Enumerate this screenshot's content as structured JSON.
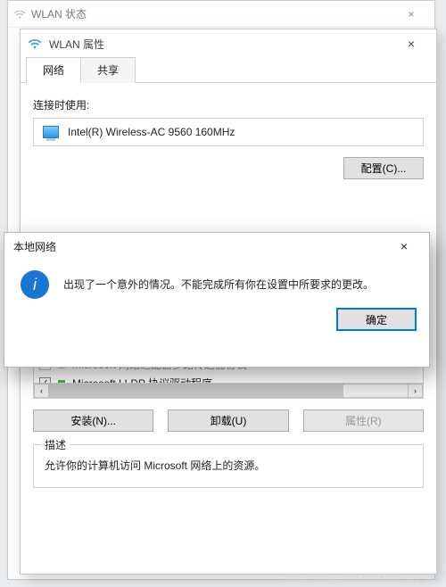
{
  "status_window": {
    "title": "WLAN 状态"
  },
  "prop_window": {
    "title": "WLAN 属性",
    "tabs": {
      "network": "网络",
      "sharing": "共享"
    },
    "connect_using_label": "连接时使用:",
    "adapter_name": "Intel(R) Wireless-AC 9560 160MHz",
    "configure_btn": "配置(C)...",
    "protocols": [
      {
        "checked": true,
        "name": "Microsoft 网络适配器多路传送器协议"
      },
      {
        "checked": true,
        "name": "Microsoft LLDP 协议驱动程序"
      }
    ],
    "install_btn": "安装(N)...",
    "uninstall_btn": "卸载(U)",
    "properties_btn": "属性(R)",
    "desc_legend": "描述",
    "desc_text": "允许你的计算机访问 Microsoft 网络上的资源。"
  },
  "modal": {
    "title": "本地网络",
    "message": "出现了一个意外的情况。不能完成所有你在设置中所要求的更改。",
    "ok": "确定"
  },
  "icons": {
    "close": "×",
    "check": "✓",
    "left": "‹",
    "right": "›",
    "info": "i"
  },
  "watermark": "https://blog.csdn.net/Kyrie_py_css"
}
